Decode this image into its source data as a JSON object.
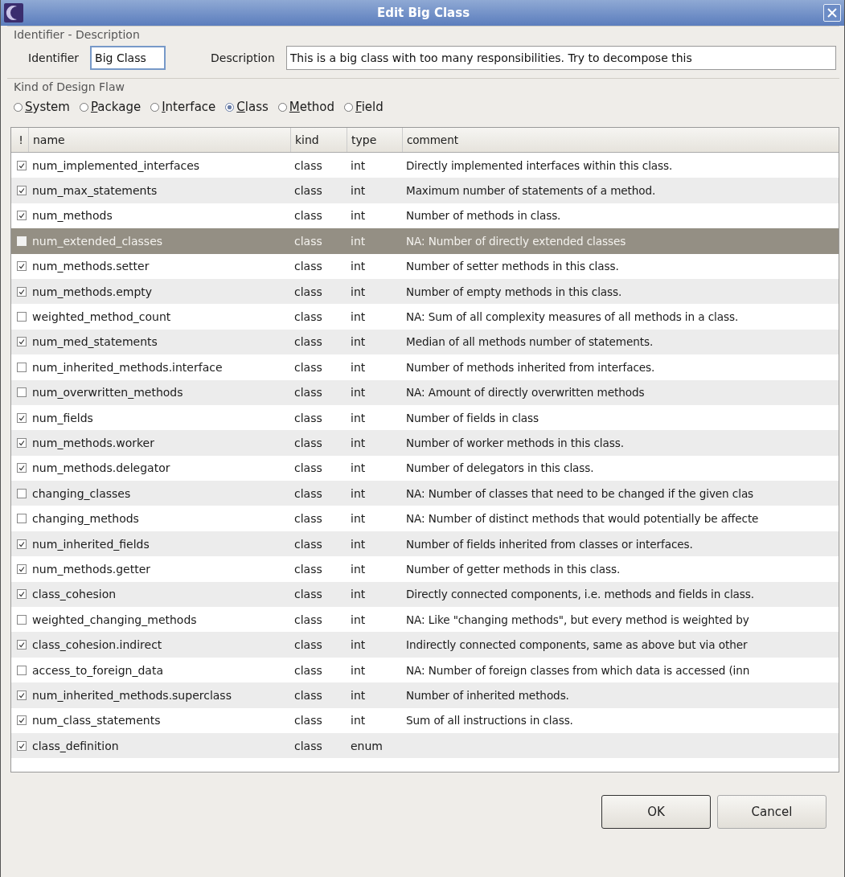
{
  "window": {
    "title": "Edit Big Class"
  },
  "identifier_group": {
    "title": "Identifier - Description",
    "identifier_label": "Identifier",
    "identifier_value": "Big Class",
    "description_label": "Description",
    "description_value": "This is a big class with too many responsibilities. Try to decompose this"
  },
  "flaw_group": {
    "title": "Kind of Design Flaw",
    "options": [
      {
        "label": "System",
        "selected": false
      },
      {
        "label": "Package",
        "selected": false
      },
      {
        "label": "Interface",
        "selected": false
      },
      {
        "label": "Class",
        "selected": true
      },
      {
        "label": "Method",
        "selected": false
      },
      {
        "label": "Field",
        "selected": false
      }
    ]
  },
  "table": {
    "columns": [
      "!",
      "name",
      "kind",
      "type",
      "comment"
    ],
    "rows": [
      {
        "checked": true,
        "selected": false,
        "name": "num_implemented_interfaces",
        "kind": "class",
        "type": "int",
        "comment": "Directly implemented interfaces within this class."
      },
      {
        "checked": true,
        "selected": false,
        "name": "num_max_statements",
        "kind": "class",
        "type": "int",
        "comment": "Maximum number of statements of a method."
      },
      {
        "checked": true,
        "selected": false,
        "name": "num_methods",
        "kind": "class",
        "type": "int",
        "comment": "Number of methods in class."
      },
      {
        "checked": false,
        "selected": true,
        "name": "num_extended_classes",
        "kind": "class",
        "type": "int",
        "comment": "NA: Number of directly extended classes"
      },
      {
        "checked": true,
        "selected": false,
        "name": "num_methods.setter",
        "kind": "class",
        "type": "int",
        "comment": "Number of setter methods in this class."
      },
      {
        "checked": true,
        "selected": false,
        "name": "num_methods.empty",
        "kind": "class",
        "type": "int",
        "comment": "Number of empty methods in this class."
      },
      {
        "checked": false,
        "selected": false,
        "name": "weighted_method_count",
        "kind": "class",
        "type": "int",
        "comment": "NA: Sum of all complexity measures of all methods in a class."
      },
      {
        "checked": true,
        "selected": false,
        "name": "num_med_statements",
        "kind": "class",
        "type": "int",
        "comment": "Median of all methods number of statements."
      },
      {
        "checked": false,
        "selected": false,
        "name": "num_inherited_methods.interface",
        "kind": "class",
        "type": "int",
        "comment": "Number of methods inherited from interfaces."
      },
      {
        "checked": false,
        "selected": false,
        "name": "num_overwritten_methods",
        "kind": "class",
        "type": "int",
        "comment": "NA: Amount of directly overwritten methods"
      },
      {
        "checked": true,
        "selected": false,
        "name": "num_fields",
        "kind": "class",
        "type": "int",
        "comment": "Number of fields in class"
      },
      {
        "checked": true,
        "selected": false,
        "name": "num_methods.worker",
        "kind": "class",
        "type": "int",
        "comment": "Number of worker methods in this class."
      },
      {
        "checked": true,
        "selected": false,
        "name": "num_methods.delegator",
        "kind": "class",
        "type": "int",
        "comment": "Number of delegators in this class."
      },
      {
        "checked": false,
        "selected": false,
        "name": "changing_classes",
        "kind": "class",
        "type": "int",
        "comment": "NA: Number of classes that need to be changed if the given clas"
      },
      {
        "checked": false,
        "selected": false,
        "name": "changing_methods",
        "kind": "class",
        "type": "int",
        "comment": "NA: Number of distinct methods that would potentially be affecte"
      },
      {
        "checked": true,
        "selected": false,
        "name": "num_inherited_fields",
        "kind": "class",
        "type": "int",
        "comment": "Number of fields inherited from classes or interfaces."
      },
      {
        "checked": true,
        "selected": false,
        "name": "num_methods.getter",
        "kind": "class",
        "type": "int",
        "comment": "Number of getter methods in this class."
      },
      {
        "checked": true,
        "selected": false,
        "name": "class_cohesion",
        "kind": "class",
        "type": "int",
        "comment": "Directly connected components, i.e. methods and fields in class."
      },
      {
        "checked": false,
        "selected": false,
        "name": "weighted_changing_methods",
        "kind": "class",
        "type": "int",
        "comment": "NA: Like \"changing methods\", but every method is weighted by"
      },
      {
        "checked": true,
        "selected": false,
        "name": "class_cohesion.indirect",
        "kind": "class",
        "type": "int",
        "comment": "Indirectly connected components, same as above but via other"
      },
      {
        "checked": false,
        "selected": false,
        "name": "access_to_foreign_data",
        "kind": "class",
        "type": "int",
        "comment": "NA: Number of foreign classes from which data is accessed (inn"
      },
      {
        "checked": true,
        "selected": false,
        "name": "num_inherited_methods.superclass",
        "kind": "class",
        "type": "int",
        "comment": "Number of inherited methods."
      },
      {
        "checked": true,
        "selected": false,
        "name": "num_class_statements",
        "kind": "class",
        "type": "int",
        "comment": "Sum of all instructions in class."
      },
      {
        "checked": true,
        "selected": false,
        "name": "class_definition",
        "kind": "class",
        "type": "enum"
      }
    ]
  },
  "buttons": [
    "OK",
    "Cancel"
  ]
}
